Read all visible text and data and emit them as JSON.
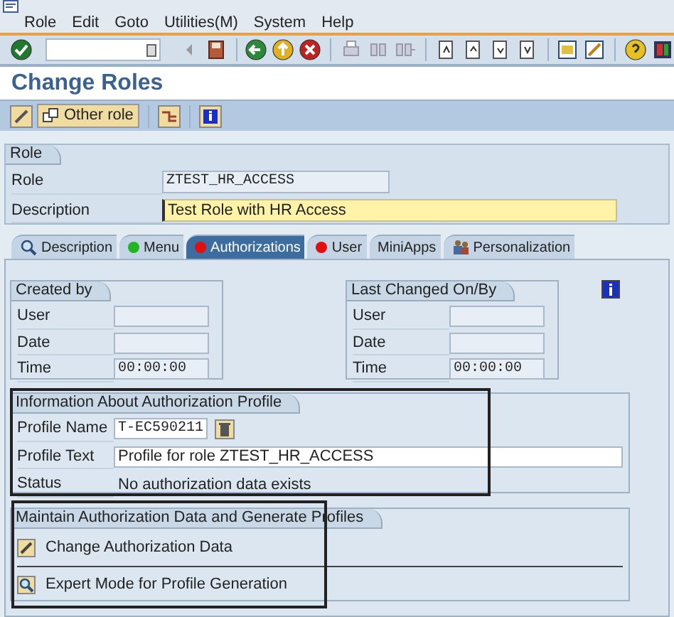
{
  "menu": [
    {
      "label": "Role"
    },
    {
      "label": "Edit"
    },
    {
      "label": "Goto"
    },
    {
      "label": "Utilities(M)"
    },
    {
      "label": "System"
    },
    {
      "label": "Help"
    }
  ],
  "title": "Change Roles",
  "app_toolbar": {
    "other_role_button": "Other role"
  },
  "role_group": {
    "title": "Role",
    "fields": [
      {
        "label": "Role",
        "value": "ZTEST_HR_ACCESS",
        "kind": "display"
      },
      {
        "label": "Description",
        "value": "Test Role with HR Access",
        "kind": "required"
      }
    ]
  },
  "tabs": [
    {
      "label": "Description",
      "kind": "search",
      "selected": false
    },
    {
      "label": "Menu",
      "kind": "dot",
      "color": "#22b422",
      "selected": false
    },
    {
      "label": "Authorizations",
      "kind": "dot",
      "color": "#e01010",
      "selected": true
    },
    {
      "label": "User",
      "kind": "dot",
      "color": "#e01010",
      "selected": false
    },
    {
      "label": "MiniApps",
      "kind": "plain",
      "selected": false
    },
    {
      "label": "Personalization",
      "kind": "people",
      "selected": false
    }
  ],
  "created_by": {
    "title": "Created by",
    "fields": [
      {
        "label": "User"
      },
      {
        "label": "Date"
      },
      {
        "label": "Time",
        "value": "00:00:00"
      }
    ]
  },
  "last_changed": {
    "title": "Last Changed On/By",
    "fields": [
      {
        "label": "User"
      },
      {
        "label": "Date"
      },
      {
        "label": "Time",
        "value": "00:00:00"
      }
    ]
  },
  "profile_info": {
    "title": "Information About Authorization Profile",
    "profile_name_label": "Profile Name",
    "profile_name": "T-EC590211",
    "profile_text_label": "Profile Text",
    "profile_text": "Profile for role ZTEST_HR_ACCESS",
    "status_label": "Status",
    "status": "No authorization data exists"
  },
  "maintain": {
    "title": "Maintain Authorization Data and Generate Profiles",
    "actions": [
      {
        "label": "Change Authorization Data",
        "kind": "pencil"
      },
      {
        "label": "Expert Mode for Profile Generation",
        "kind": "search"
      }
    ]
  }
}
